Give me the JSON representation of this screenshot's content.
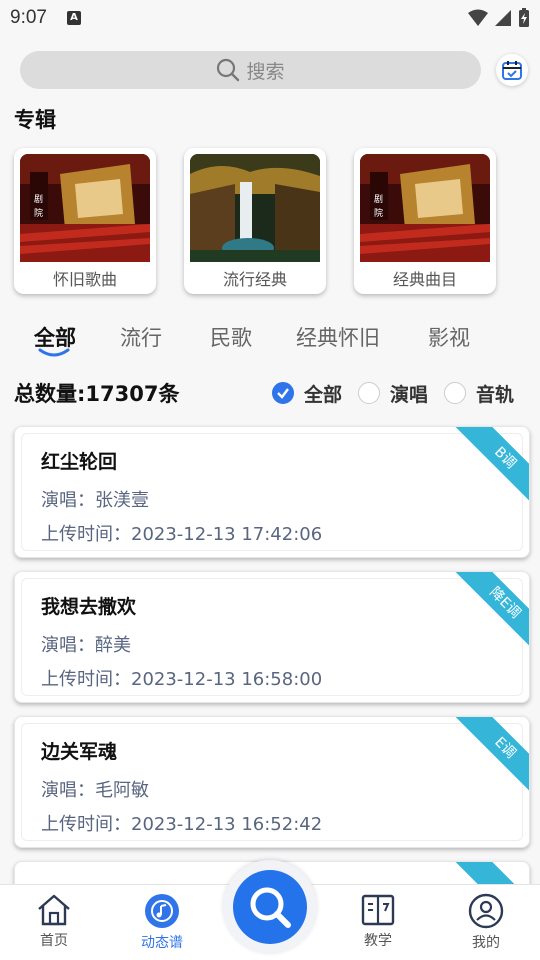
{
  "status_bar": {
    "time": "9:07",
    "app_badge": "A"
  },
  "search": {
    "placeholder": "搜索"
  },
  "section": {
    "title": "专辑"
  },
  "albums": [
    {
      "label": "怀旧歌曲",
      "cover": "theater"
    },
    {
      "label": "流行经典",
      "cover": "waterfall"
    },
    {
      "label": "经典曲目",
      "cover": "theater"
    }
  ],
  "tabs": [
    {
      "label": "全部",
      "active": true
    },
    {
      "label": "流行",
      "active": false
    },
    {
      "label": "民歌",
      "active": false
    },
    {
      "label": "经典怀旧",
      "active": false
    },
    {
      "label": "影视",
      "active": false
    }
  ],
  "summary": {
    "total": "总数量:17307条"
  },
  "filters": [
    {
      "label": "全部",
      "checked": true
    },
    {
      "label": "演唱",
      "checked": false
    },
    {
      "label": "音轨",
      "checked": false
    }
  ],
  "songs": [
    {
      "title": "红尘轮回",
      "singer": "演唱：张渼壹",
      "uploaded": "上传时间：2023-12-13 17:42:06",
      "key": "B调"
    },
    {
      "title": "我想去撒欢",
      "singer": "演唱：醉美",
      "uploaded": "上传时间：2023-12-13 16:58:00",
      "key": "降E调"
    },
    {
      "title": "边关军魂",
      "singer": "演唱：毛阿敏",
      "uploaded": "上传时间：2023-12-13 16:52:42",
      "key": "E调"
    }
  ],
  "nav": {
    "home": "首页",
    "dynamic": "动态谱",
    "teach": "教学",
    "mine": "我的"
  },
  "colors": {
    "accent": "#2f74e8",
    "ribbon": "#35b6d8",
    "search_bg": "#dcdcdc"
  }
}
